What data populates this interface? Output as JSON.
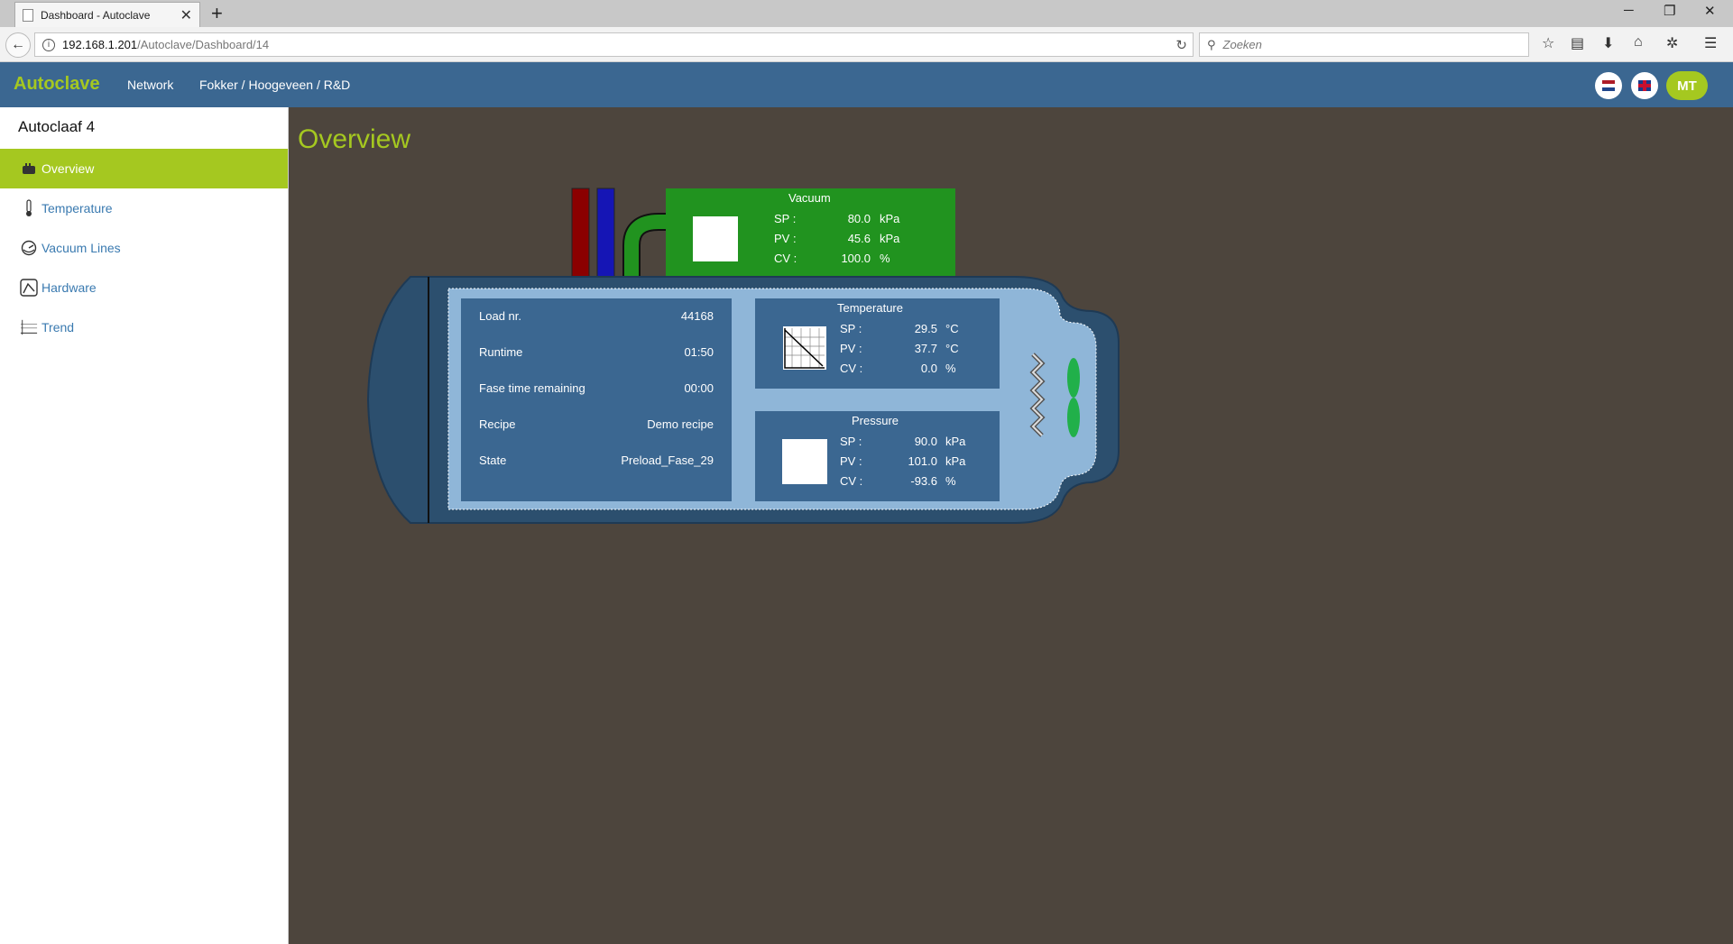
{
  "browser": {
    "tab_title": "Dashboard - Autoclave",
    "url_host": "192.168.1.201",
    "url_path": "/Autoclave/Dashboard/14",
    "search_placeholder": "Zoeken"
  },
  "header": {
    "brand": "Autoclave",
    "nav": [
      "Network",
      "Fokker / Hoogeveen / R&D"
    ],
    "user_initials": "MT"
  },
  "sidebar": {
    "title": "Autoclaaf 4",
    "items": [
      {
        "label": "Overview",
        "icon": "autoclave-icon",
        "active": true
      },
      {
        "label": "Temperature",
        "icon": "thermometer-icon",
        "active": false
      },
      {
        "label": "Vacuum Lines",
        "icon": "gauge-icon",
        "active": false
      },
      {
        "label": "Hardware",
        "icon": "hardware-icon",
        "active": false
      },
      {
        "label": "Trend",
        "icon": "trend-icon",
        "active": false
      }
    ]
  },
  "main": {
    "title": "Overview",
    "info": {
      "rows": [
        {
          "label": "Load nr.",
          "value": "44168"
        },
        {
          "label": "Runtime",
          "value": "01:50"
        },
        {
          "label": "Fase time remaining",
          "value": "00:00"
        },
        {
          "label": "Recipe",
          "value": "Demo recipe"
        },
        {
          "label": "State",
          "value": "Preload_Fase_29"
        }
      ]
    },
    "vacuum": {
      "title": "Vacuum",
      "rows": [
        {
          "label": "SP :",
          "value": "80.0",
          "unit": "kPa"
        },
        {
          "label": "PV :",
          "value": "45.6",
          "unit": "kPa"
        },
        {
          "label": "CV :",
          "value": "100.0",
          "unit": "%"
        }
      ]
    },
    "temperature": {
      "title": "Temperature",
      "rows": [
        {
          "label": "SP :",
          "value": "29.5",
          "unit": "°C"
        },
        {
          "label": "PV :",
          "value": "37.7",
          "unit": "°C"
        },
        {
          "label": "CV :",
          "value": "0.0",
          "unit": "%"
        }
      ]
    },
    "pressure": {
      "title": "Pressure",
      "rows": [
        {
          "label": "SP :",
          "value": "90.0",
          "unit": "kPa"
        },
        {
          "label": "PV :",
          "value": "101.0",
          "unit": "kPa"
        },
        {
          "label": "CV :",
          "value": "-93.6",
          "unit": "%"
        }
      ]
    }
  },
  "colors": {
    "brand_green": "#a5c820",
    "header_blue": "#3b6791",
    "vacuum_green": "#21931f",
    "panel_blue": "#3b6791",
    "vessel_dark": "#2c4f6e",
    "vessel_light": "#8fb6d8",
    "background": "#4d453d"
  }
}
